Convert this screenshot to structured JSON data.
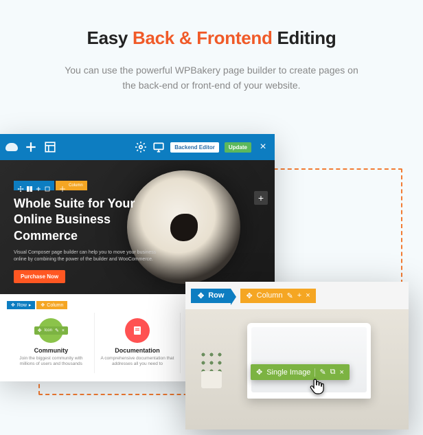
{
  "header": {
    "title_pre": "Easy ",
    "title_accent": "Back & Frontend",
    "title_post": " Editing",
    "subtitle": "You can use the powerful WPBakery page builder to create pages on the back-end or front-end of your website."
  },
  "topbar": {
    "backend_label": "Backend Editor",
    "update_label": "Update"
  },
  "hero": {
    "title": "Whole Suite for Your Online Business Commerce",
    "desc": "Visual Composer page builder can help you to move your business online by combining the power of the builder and WooCommerce.",
    "cta": "Purchase Now"
  },
  "row_control": {
    "row_label": "Row",
    "column_label": "Column"
  },
  "cards": [
    {
      "title": "Community",
      "desc": "Join the biggest community with millions of users and thousands"
    },
    {
      "title": "Documentation",
      "desc": "A comprehensive documentation that addresses all you need to"
    }
  ],
  "popup": {
    "row_label": "Row",
    "column_label": "Column",
    "single_image_label": "Single Image"
  },
  "icons": {
    "move": "move-icon",
    "pencil": "pencil-icon",
    "plus": "plus-icon",
    "close": "close-icon",
    "copy": "copy-icon",
    "gear": "gear-icon",
    "monitor": "monitor-icon",
    "layout": "layout-icon"
  }
}
